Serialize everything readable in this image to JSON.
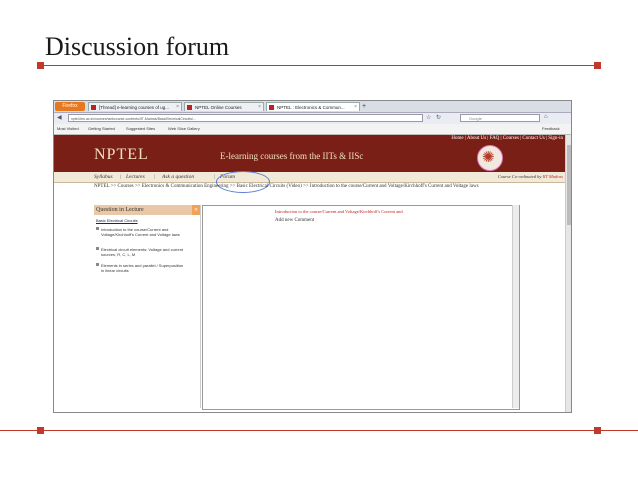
{
  "slide": {
    "title": "Discussion forum"
  },
  "browser": {
    "app_button": "Firefox",
    "tabs": [
      {
        "label": "[Thread] e-learning courses of ug..."
      },
      {
        "label": "NPTEL Online Courses"
      },
      {
        "label": "NPTEL : Electronics & Commun..."
      }
    ],
    "url": "nptel.iitm.ac.in/courses/webcourse-contents/IIT-Madras/BasicElectricalCircuits/...",
    "search_placeholder": "Google",
    "feedback": "Feedback",
    "bookmarks": [
      "Most Visited",
      "Getting Started",
      "Suggested Sites",
      "Web Slice Gallery"
    ]
  },
  "site": {
    "toplinks": "Home | About Us | FAQ | Courses | Contact Us | Sign-in",
    "logo": "NPTEL",
    "tagline": "E-learning courses from the IITs & IISc",
    "menu": [
      "Syllabus",
      "Lectures",
      "Ask a question",
      "Forum"
    ],
    "credit_prefix": "Course Co-ordinated by",
    "credit_org": "IIT Madras",
    "breadcrumb": "NPTEL >> Courses >> Electronics & Communication Engineering >> Basic Electrical Circuits (Video) >> Introduction to the course/Current and Voltage/Kirchhoff's Current and Voltage laws",
    "sidebar": {
      "heading": "Question in Lecture",
      "subheading": "Basic Electrical Circuits",
      "items": [
        "Introduction to the course/Current and Voltage/Kirchhoff's Current and Voltage laws",
        "Electrical circuit elements: Voltage and current sources, R, C, L, M",
        "Elements in series and parallel / Superposition in linear circuits"
      ]
    },
    "content": {
      "link": "Introduction to the course/Current and Voltage/Kirchhoff's Current and",
      "add_comment": "Add new Comment"
    }
  }
}
